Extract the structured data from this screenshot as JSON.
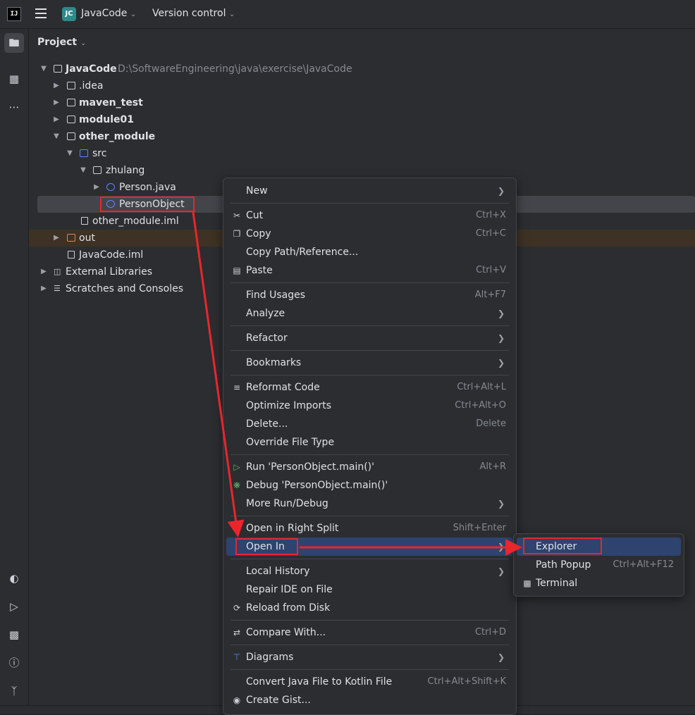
{
  "header": {
    "logo": "IJ",
    "project_badge": "JC",
    "project_name": "JavaCode",
    "version_control": "Version control"
  },
  "sidebar_icons": [
    "folder-icon",
    "structure-icon",
    "more-icon",
    "profiler-icon",
    "run-icon",
    "terminal-icon",
    "problems-icon",
    "git-icon"
  ],
  "panel": {
    "title": "Project"
  },
  "tree": {
    "root_name": "JavaCode",
    "root_path": "D:\\SoftwareEngineering\\java\\exercise\\JavaCode",
    "idea": ".idea",
    "maven_test": "maven_test",
    "module01": "module01",
    "other_module": "other_module",
    "src": "src",
    "zhulang": "zhulang",
    "person_java": "Person.java",
    "person_object": "PersonObject",
    "other_module_iml": "other_module.iml",
    "out": "out",
    "javacode_iml": "JavaCode.iml",
    "external_libraries": "External Libraries",
    "scratches": "Scratches and Consoles"
  },
  "context_menu": {
    "new": "New",
    "cut": "Cut",
    "cut_sc": "Ctrl+X",
    "copy": "Copy",
    "copy_sc": "Ctrl+C",
    "copy_path": "Copy Path/Reference...",
    "paste": "Paste",
    "paste_sc": "Ctrl+V",
    "find_usages": "Find Usages",
    "find_usages_sc": "Alt+F7",
    "analyze": "Analyze",
    "refactor": "Refactor",
    "bookmarks": "Bookmarks",
    "reformat": "Reformat Code",
    "reformat_sc": "Ctrl+Alt+L",
    "optimize": "Optimize Imports",
    "optimize_sc": "Ctrl+Alt+O",
    "delete": "Delete...",
    "delete_sc": "Delete",
    "override": "Override File Type",
    "run": "Run 'PersonObject.main()'",
    "run_sc": "Alt+R",
    "debug": "Debug 'PersonObject.main()'",
    "more_run": "More Run/Debug",
    "open_right": "Open in Right Split",
    "open_right_sc": "Shift+Enter",
    "open_in": "Open In",
    "local_history": "Local History",
    "repair": "Repair IDE on File",
    "reload": "Reload from Disk",
    "compare": "Compare With...",
    "compare_sc": "Ctrl+D",
    "diagrams": "Diagrams",
    "convert": "Convert Java File to Kotlin File",
    "convert_sc": "Ctrl+Alt+Shift+K",
    "gist": "Create Gist..."
  },
  "submenu": {
    "explorer": "Explorer",
    "path_popup": "Path Popup",
    "path_popup_sc": "Ctrl+Alt+F12",
    "terminal": "Terminal"
  },
  "colors": {
    "accent": "#2e436e",
    "annotation_red": "#e8262c"
  }
}
